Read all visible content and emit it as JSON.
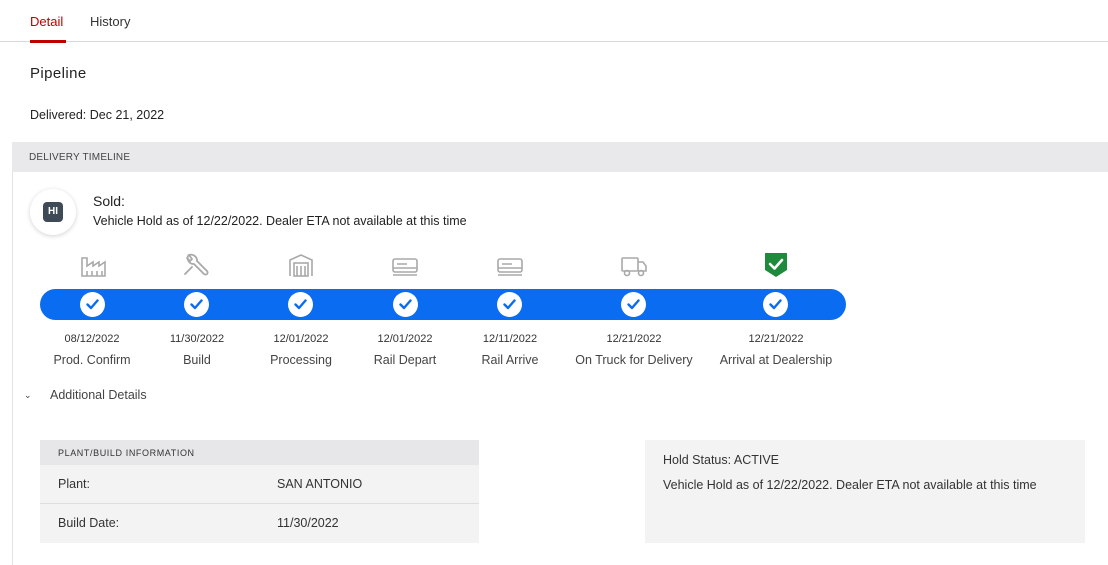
{
  "tabs": [
    {
      "label": "Detail",
      "active": true
    },
    {
      "label": "History",
      "active": false
    }
  ],
  "page_title": "Pipeline",
  "delivered": "Delivered: Dec 21, 2022",
  "timeline_header": "DELIVERY TIMELINE",
  "status": {
    "avatar_initials": "HI",
    "title": "Sold:",
    "description": "Vehicle Hold as of 12/22/2022. Dealer ETA not available at this time"
  },
  "stages": [
    {
      "date": "08/12/2022",
      "label": "Prod. Confirm",
      "icon": "factory-icon",
      "completed": true
    },
    {
      "date": "11/30/2022",
      "label": "Build",
      "icon": "wrench-icon",
      "completed": true
    },
    {
      "date": "12/01/2022",
      "label": "Processing",
      "icon": "processing-icon",
      "completed": true
    },
    {
      "date": "12/01/2022",
      "label": "Rail Depart",
      "icon": "rail-car-icon",
      "completed": true
    },
    {
      "date": "12/11/2022",
      "label": "Rail Arrive",
      "icon": "rail-car-icon",
      "completed": true
    },
    {
      "date": "12/21/2022",
      "label": "On Truck for Delivery",
      "icon": "truck-icon",
      "completed": true
    },
    {
      "date": "12/21/2022",
      "label": "Arrival at Dealership",
      "icon": "shield-check-icon",
      "completed": true
    }
  ],
  "additional_details_label": "Additional Details",
  "plant_info": {
    "header": "PLANT/BUILD INFORMATION",
    "rows": [
      {
        "key": "Plant:",
        "value": "SAN ANTONIO"
      },
      {
        "key": "Build Date:",
        "value": "11/30/2022"
      }
    ]
  },
  "hold": {
    "status": "Hold Status: ACTIVE",
    "note": "Vehicle Hold as of 12/22/2022. Dealer ETA not available at this time"
  },
  "colors": {
    "accent_red": "#c00000",
    "progress_blue": "#0a6cf0",
    "success_green": "#1e8a3c",
    "icon_gray": "#a9a9a9"
  }
}
